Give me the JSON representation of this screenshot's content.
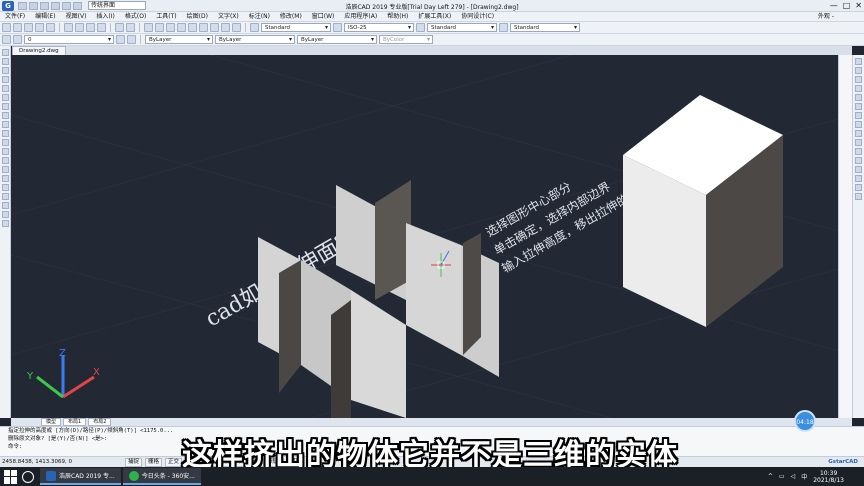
{
  "titlebar": {
    "workspace": "传统界面",
    "title": "浩辰CAD 2019 专业版[Trial Day Left 279] - [Drawing2.dwg]",
    "minimize": "—",
    "maximize": "□",
    "close": "✕"
  },
  "menu": {
    "items": [
      "文件(F)",
      "编辑(E)",
      "视图(V)",
      "插入(I)",
      "格式(O)",
      "工具(T)",
      "绘图(D)",
      "文字(X)",
      "标注(N)",
      "修改(M)",
      "窗口(W)",
      "应用程序(A)",
      "帮助(H)",
      "扩展工具(X)",
      "协同设计(C)"
    ],
    "right": "外观 -"
  },
  "toolbar2": {
    "text_style": "Standard",
    "dim_style": "ISO-25",
    "table_style": "Standard",
    "mleader_style": "Standard"
  },
  "toolbar3": {
    "layer": "0",
    "color": "ByLayer",
    "linetype": "ByLayer",
    "lineweight": "ByLayer",
    "plotstyle": "ByColor"
  },
  "doc_tabs": [
    "Drawing2.dwg"
  ],
  "canvas_text": {
    "title_line": "cad如何拉伸面?",
    "right_line1": "选择图形中心部分",
    "right_line2": "单击确定，选择内部边界",
    "right_line3": "输入拉伸高度，移出拉伸的边界"
  },
  "axes": {
    "x": "X",
    "y": "Y",
    "z": "Z"
  },
  "layout_tabs": [
    "模型",
    "布局1",
    "布局2"
  ],
  "command_lines": [
    "指定拉伸的高度或 [方向(D)/路径(P)/倾斜角(T)] <1175.0...",
    "删除原文对象? [是(Y)/否(N)] <是>:",
    "命令:"
  ],
  "status": {
    "coords": "2458.8438, 1413.3069, 0",
    "buttons": [
      "捕捉",
      "栅格",
      "正交",
      "极轴",
      "对象捕捉",
      "对象追踪",
      "线宽",
      "模型"
    ],
    "brand": "GstarCAD"
  },
  "taskbar": {
    "apps": [
      {
        "label": "浩辰CAD 2019 专...",
        "color": "#2a62b5"
      },
      {
        "label": "今日头条 - 360安...",
        "color": "#2fb24a"
      }
    ],
    "time": "10:39",
    "date": "2021/8/13"
  },
  "subtitle": "这样挤出的物体它并不是三维的实体",
  "timer": "04:18"
}
